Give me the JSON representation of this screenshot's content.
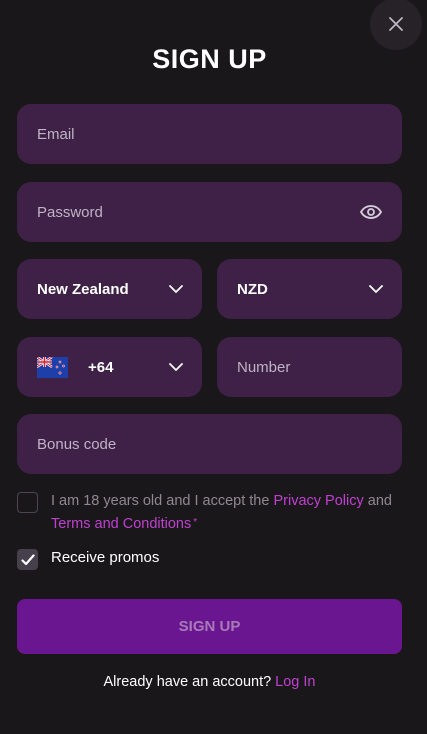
{
  "modal": {
    "title": "SIGN UP",
    "close_icon": "close-icon"
  },
  "form": {
    "email": {
      "placeholder": "Email",
      "value": ""
    },
    "password": {
      "placeholder": "Password",
      "value": "",
      "toggle_icon": "eye-icon"
    },
    "country": {
      "selected": "New Zealand",
      "icon": "chevron-down-icon"
    },
    "currency": {
      "selected": "NZD",
      "icon": "chevron-down-icon"
    },
    "phone_code": {
      "flag_icon": "new-zealand-flag-icon",
      "value": "+64",
      "icon": "chevron-down-icon"
    },
    "number": {
      "placeholder": "Number",
      "value": ""
    },
    "bonus_code": {
      "placeholder": "Bonus code",
      "value": ""
    }
  },
  "consent": {
    "text_before": "I am 18 years old and I accept the",
    "privacy_link": "Privacy Policy",
    "and": "and",
    "terms_link": "Terms and Conditions",
    "required_mark": "*",
    "checked": false
  },
  "promos": {
    "label": "Receive promos",
    "checked": true
  },
  "submit": {
    "label": "SIGN UP"
  },
  "footer": {
    "question": "Already have an account?",
    "login_link": "Log In"
  },
  "colors": {
    "background": "#1a171b",
    "field": "#3f2148",
    "accent_link": "#c040d0",
    "button": "#6a1690",
    "button_text": "#a77bb8"
  }
}
